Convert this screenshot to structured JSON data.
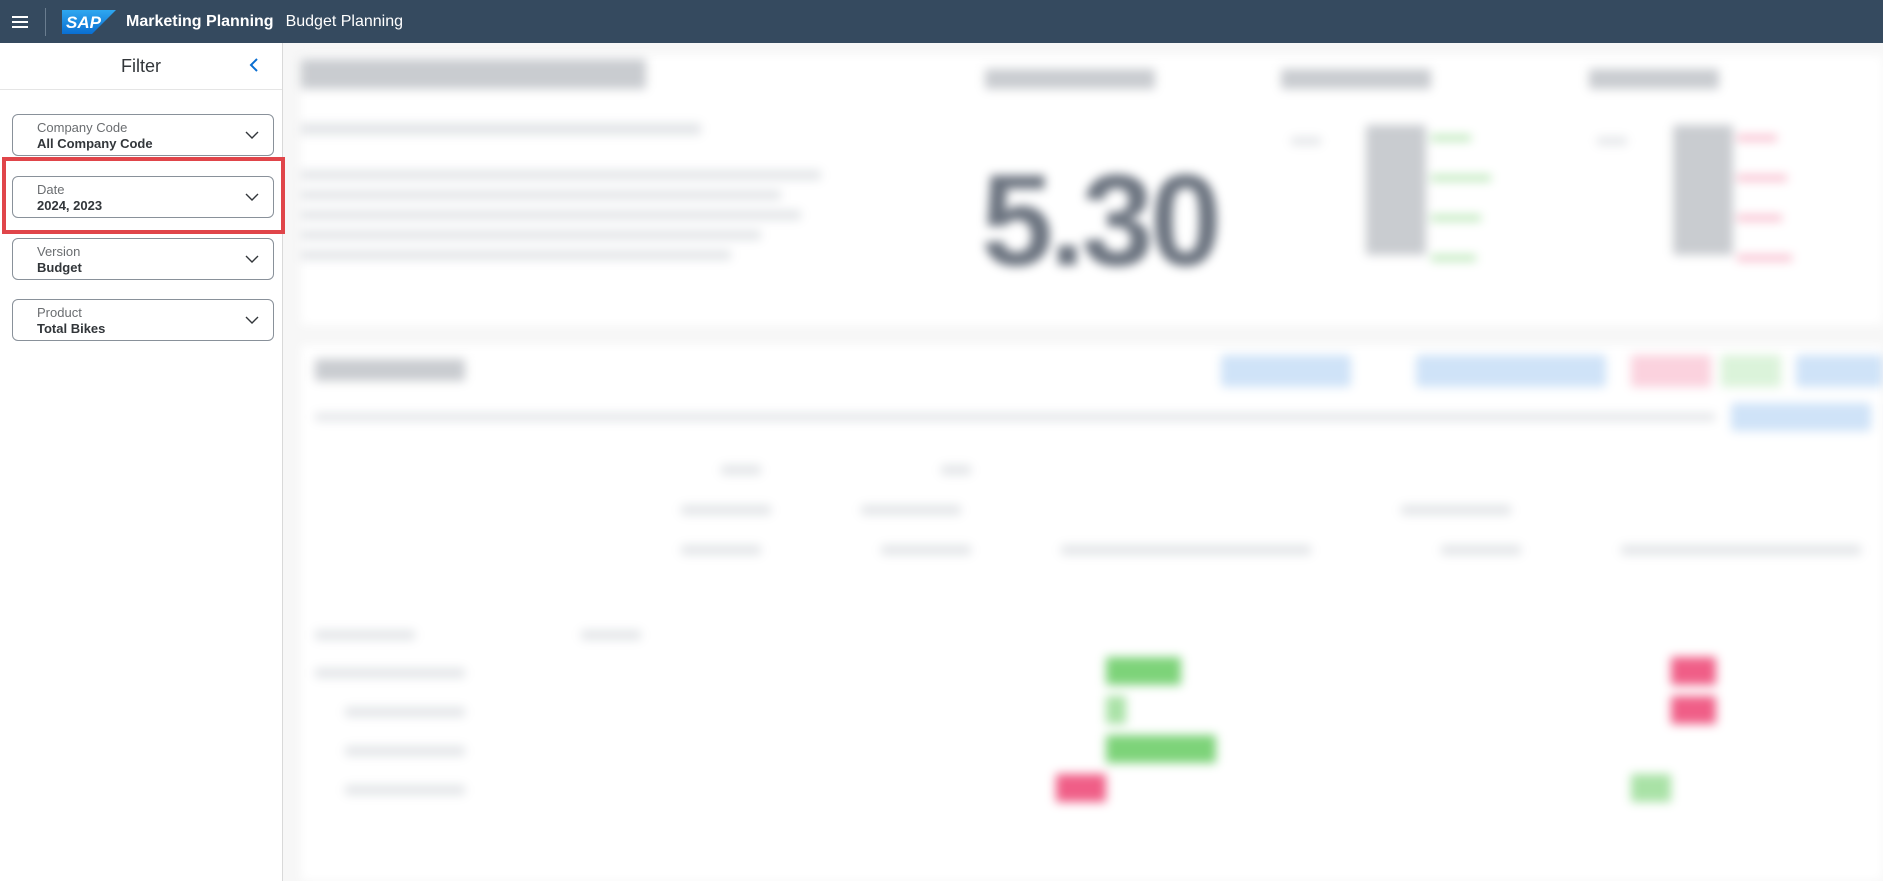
{
  "shell": {
    "logo_text": "SAP",
    "app_title": "Marketing Planning",
    "app_subtitle": "Budget Planning"
  },
  "filter": {
    "title": "Filter",
    "fields": [
      {
        "label": "Company Code",
        "value": "All Company Code"
      },
      {
        "label": "Date",
        "value": "2024, 2023"
      },
      {
        "label": "Version",
        "value": "Budget"
      },
      {
        "label": "Product",
        "value": "Total Bikes"
      }
    ]
  },
  "kpi": {
    "big_value": "5.30"
  },
  "colors": {
    "shell_bg": "#354a5f",
    "highlight": "#e0454a",
    "accent": "#0a6ed1"
  }
}
